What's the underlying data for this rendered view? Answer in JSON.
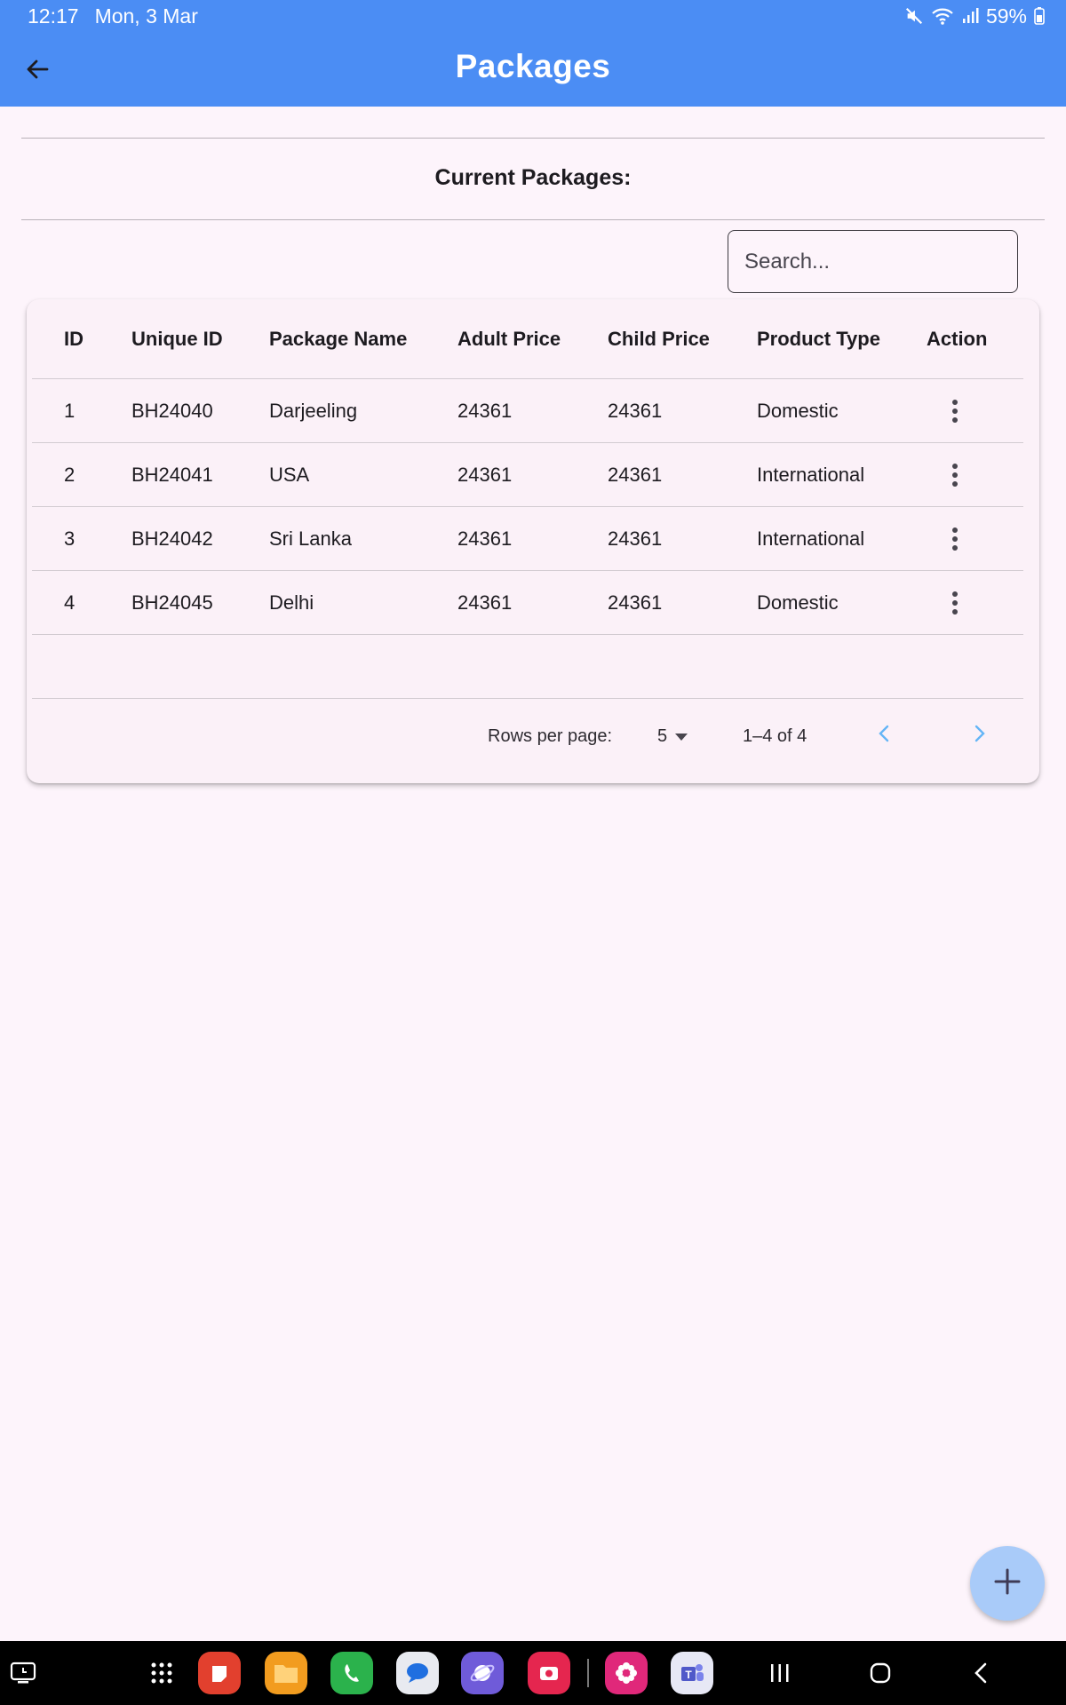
{
  "status_bar": {
    "time": "12:17",
    "date": "Mon, 3 Mar",
    "battery": "59%"
  },
  "app_bar": {
    "title": "Packages"
  },
  "section": {
    "title": "Current Packages:"
  },
  "search": {
    "placeholder": "Search..."
  },
  "table": {
    "columns": [
      "ID",
      "Unique ID",
      "Package Name",
      "Adult Price",
      "Child Price",
      "Product Type",
      "Action"
    ],
    "rows": [
      {
        "id": "1",
        "unique_id": "BH24040",
        "name": "Darjeeling",
        "adult_price": "24361",
        "child_price": "24361",
        "type": "Domestic"
      },
      {
        "id": "2",
        "unique_id": "BH24041",
        "name": "USA",
        "adult_price": "24361",
        "child_price": "24361",
        "type": "International"
      },
      {
        "id": "3",
        "unique_id": "BH24042",
        "name": "Sri Lanka",
        "adult_price": "24361",
        "child_price": "24361",
        "type": "International"
      },
      {
        "id": "4",
        "unique_id": "BH24045",
        "name": "Delhi",
        "adult_price": "24361",
        "child_price": "24361",
        "type": "Domestic"
      }
    ]
  },
  "pagination": {
    "rows_per_page_label": "Rows per page:",
    "rows_per_page": "5",
    "range": "1–4 of 4"
  },
  "colors": {
    "app_bar": "#4b8df4",
    "background": "#fdf4fb",
    "fab": "#a9cbf9",
    "pager_arrow": "#64b5f6"
  },
  "nav_bar": {
    "apps": [
      "samsung-notes-icon",
      "my-files-icon",
      "phone-icon",
      "messages-icon",
      "samsung-internet-icon",
      "screen-recorder-icon",
      "gallery-icon",
      "teams-icon"
    ]
  }
}
